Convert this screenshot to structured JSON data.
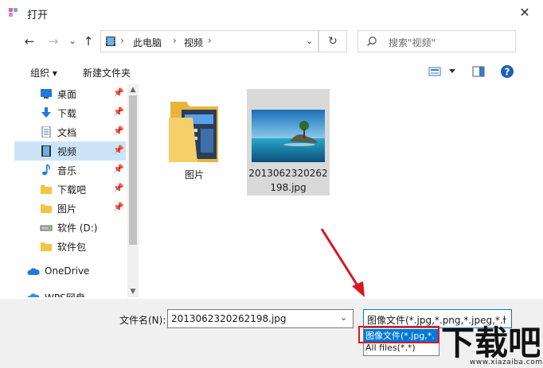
{
  "window": {
    "title": "打开",
    "close_symbol": "✕"
  },
  "nav": {
    "back": "←",
    "forward": "→",
    "recent": "⌄",
    "up": "↑"
  },
  "breadcrumb": [
    {
      "label": "此电脑"
    },
    {
      "label": "视频"
    }
  ],
  "breadcrumb_separator": "›",
  "address_dropdown": "⌄",
  "refresh_symbol": "↻",
  "search": {
    "placeholder": "搜索\"视频\""
  },
  "toolbar": {
    "organize": "组织 ▾",
    "new_folder": "新建文件夹"
  },
  "sidebar": {
    "items": [
      {
        "label": "桌面",
        "icon": "desktop-icon",
        "pinned": true
      },
      {
        "label": "下载",
        "icon": "download-icon",
        "pinned": true
      },
      {
        "label": "文档",
        "icon": "document-icon",
        "pinned": true
      },
      {
        "label": "视频",
        "icon": "video-icon",
        "pinned": true,
        "selected": true
      },
      {
        "label": "音乐",
        "icon": "music-icon",
        "pinned": true
      },
      {
        "label": "下载吧",
        "icon": "folder-icon",
        "pinned": true
      },
      {
        "label": "图片",
        "icon": "folder-icon",
        "pinned": true
      },
      {
        "label": "软件 (D:)",
        "icon": "drive-icon",
        "pinned": false
      },
      {
        "label": "软件包",
        "icon": "folder-icon",
        "pinned": false
      },
      {
        "label": "OneDrive",
        "icon": "cloud-icon",
        "pinned": false
      },
      {
        "label": "WPS网盘",
        "icon": "cloud-icon",
        "pinned": false
      }
    ],
    "pin_symbol": "📌"
  },
  "files": [
    {
      "name": "图片",
      "type": "folder"
    },
    {
      "name_line1": "2013062320262",
      "name_line2": "198.jpg",
      "type": "image"
    }
  ],
  "bottom": {
    "filename_label": "文件名(N):",
    "filename_value": "2013062320262198.jpg",
    "filter_value": "图像文件(*.jpg,*.png,*.jpeg,*.l",
    "filter_options": [
      "图像文件(*.jpg,*.",
      "All files(*.*)"
    ]
  },
  "watermark": {
    "logo_text": "下载吧",
    "url": "www.xiazaiba.com"
  },
  "colors": {
    "accent": "#0078d7",
    "selection": "#cce4f7",
    "highlight_box": "#e0141e"
  }
}
